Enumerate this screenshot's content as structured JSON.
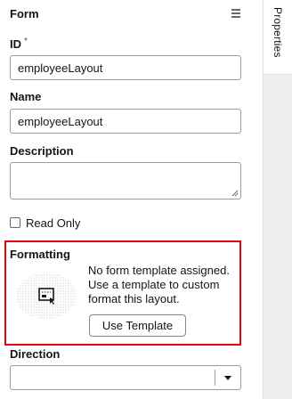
{
  "header": {
    "title": "Form",
    "menu_icon": "hamburger-icon"
  },
  "side_tab": {
    "label": "Properties"
  },
  "fields": {
    "id": {
      "label": "ID",
      "required_mark": "*",
      "value": "employeeLayout"
    },
    "name": {
      "label": "Name",
      "value": "employeeLayout"
    },
    "description": {
      "label": "Description",
      "value": ""
    },
    "read_only": {
      "label": "Read Only",
      "checked": false
    }
  },
  "formatting": {
    "title": "Formatting",
    "message": "No form template assigned. Use a template to custom format this layout.",
    "button_label": "Use Template",
    "illustration_icon": "form-template-icon",
    "highlight_color": "#e3000f"
  },
  "direction": {
    "label": "Direction",
    "value": ""
  }
}
